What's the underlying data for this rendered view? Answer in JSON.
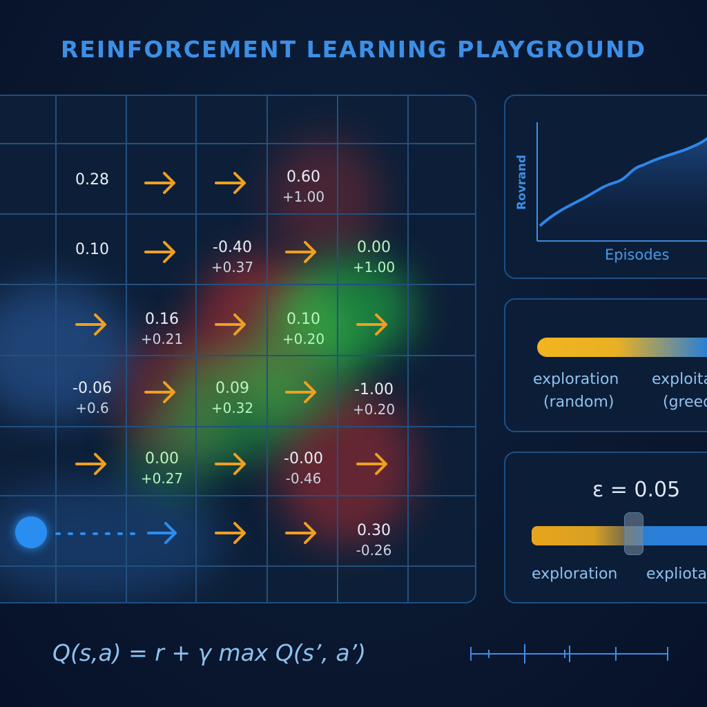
{
  "title": "REINFORCEMENT LEARNING PLAYGROUND",
  "colors": {
    "arrow": "#f0a020",
    "agent": "#2a8ef0",
    "accent": "#3d8fe6",
    "positive": "#2ecc40",
    "negative": "#e03a3a"
  },
  "grid": {
    "rows": 7,
    "cols": 7,
    "cells": [
      {
        "id": "c1-1",
        "v1": "0.28",
        "v2": ""
      },
      {
        "id": "c1-4",
        "v1": "0.60",
        "v2": "+1.00"
      },
      {
        "id": "c2-1",
        "v1": "0.10",
        "v2": ""
      },
      {
        "id": "c2-3",
        "v1": "-0.40",
        "v2": "+0.37"
      },
      {
        "id": "c2-5",
        "v1": "0.00",
        "v2": "+1.00"
      },
      {
        "id": "c3-2",
        "v1": "0.16",
        "v2": "+0.21"
      },
      {
        "id": "c3-4",
        "v1": "0.10",
        "v2": "+0.20"
      },
      {
        "id": "c4-1",
        "v1": "-0.06",
        "v2": "+0.6"
      },
      {
        "id": "c4-3",
        "v1": "0.09",
        "v2": "+0.32"
      },
      {
        "id": "c4-5",
        "v1": "-1.00",
        "v2": "+0.20"
      },
      {
        "id": "c5-2",
        "v1": "0.00",
        "v2": "+0.27"
      },
      {
        "id": "c5-4",
        "v1": "-0.00",
        "v2": "-0.46"
      },
      {
        "id": "c6-5",
        "v1": "0.30",
        "v2": "-0.26"
      }
    ],
    "arrow_direction": "right",
    "agent_icon": "agent-dot",
    "path_icon": "dotted-path"
  },
  "reward_chart": {
    "ylabel": "Rovrand",
    "xlabel": "Episodes"
  },
  "tradeoff_card": {
    "left_label_1": "exploration",
    "left_label_2": "(random)",
    "right_label_1": "exploita",
    "right_label_2": "(greed"
  },
  "epsilon_card": {
    "epsilon_label": "ε = 0.05",
    "epsilon_value": 0.05,
    "left_label": "exploration",
    "right_label": "expliota"
  },
  "formula": "Q(s,a) = r + γ max  Q(s’, a’)"
}
